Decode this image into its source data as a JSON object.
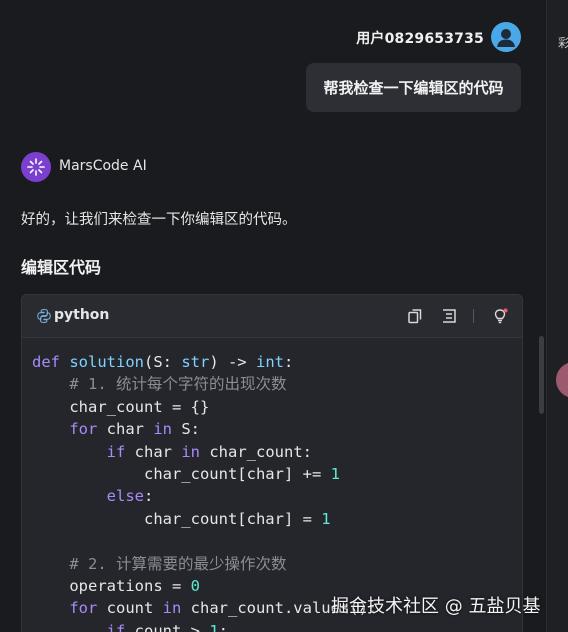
{
  "user": {
    "name": "用户0829653735",
    "message": "帮我检查一下编辑区的代码"
  },
  "assistant": {
    "name": "MarsCode AI",
    "reply": "好的，让我们来检查一下你编辑区的代码。",
    "section_title": "编辑区代码"
  },
  "code_block": {
    "language": "python",
    "lines": [
      [
        {
          "t": "kw",
          "v": "def "
        },
        {
          "t": "fn",
          "v": "solution"
        },
        {
          "t": "",
          "v": "(S: "
        },
        {
          "t": "ty",
          "v": "str"
        },
        {
          "t": "",
          "v": ") -> "
        },
        {
          "t": "ty",
          "v": "int"
        },
        {
          "t": "",
          "v": ":"
        }
      ],
      [
        {
          "t": "cm",
          "v": "    # 1. 统计每个字符的出现次数"
        }
      ],
      [
        {
          "t": "",
          "v": "    char_count = {}"
        }
      ],
      [
        {
          "t": "kw",
          "v": "    for "
        },
        {
          "t": "",
          "v": "char "
        },
        {
          "t": "kw",
          "v": "in "
        },
        {
          "t": "",
          "v": "S:"
        }
      ],
      [
        {
          "t": "kw",
          "v": "        if "
        },
        {
          "t": "",
          "v": "char "
        },
        {
          "t": "kw",
          "v": "in "
        },
        {
          "t": "",
          "v": "char_count:"
        }
      ],
      [
        {
          "t": "",
          "v": "            char_count[char] += "
        },
        {
          "t": "num",
          "v": "1"
        }
      ],
      [
        {
          "t": "kw",
          "v": "        else"
        },
        {
          "t": "",
          "v": ":"
        }
      ],
      [
        {
          "t": "",
          "v": "            char_count[char] = "
        },
        {
          "t": "num",
          "v": "1"
        }
      ],
      [
        {
          "t": "",
          "v": ""
        }
      ],
      [
        {
          "t": "cm",
          "v": "    # 2. 计算需要的最少操作次数"
        }
      ],
      [
        {
          "t": "",
          "v": "    operations = "
        },
        {
          "t": "num",
          "v": "0"
        }
      ],
      [
        {
          "t": "kw",
          "v": "    for "
        },
        {
          "t": "",
          "v": "count "
        },
        {
          "t": "kw",
          "v": "in "
        },
        {
          "t": "",
          "v": "char_count.values():"
        }
      ],
      [
        {
          "t": "kw",
          "v": "        if "
        },
        {
          "t": "",
          "v": "count > "
        },
        {
          "t": "num",
          "v": "1"
        },
        {
          "t": "",
          "v": ":"
        }
      ]
    ]
  },
  "icons": {
    "copy": "copy-icon",
    "insert": "insert-icon",
    "explain": "lightbulb-icon",
    "language": "python-icon",
    "user_avatar": "user-avatar-icon",
    "ai_logo": "marscode-logo-icon"
  },
  "watermark": "掘金技术社区 @ 五盐贝基",
  "right_panel_glyph": "彩"
}
